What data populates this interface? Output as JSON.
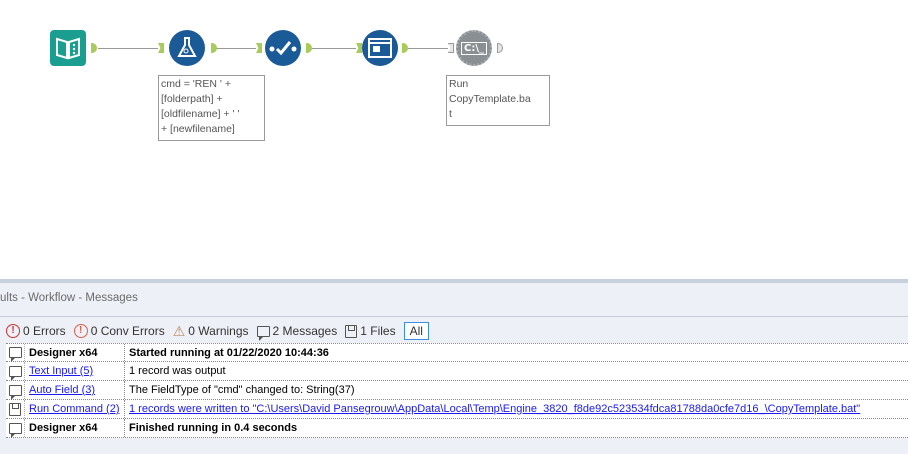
{
  "workflow": {
    "tools": [
      {
        "name": "Text Input",
        "icon": "book-icon",
        "color": "#1a9e8f"
      },
      {
        "name": "Formula",
        "icon": "flask-icon",
        "color": "#1a5a96",
        "annotation": [
          "cmd = 'REN ' +",
          "[folderpath] +",
          "[oldfilename] + ' '",
          "+ [newfilename]"
        ]
      },
      {
        "name": "Auto Field",
        "icon": "check-icon",
        "color": "#1a5a96"
      },
      {
        "name": "Run Command",
        "icon": "window-icon",
        "color": "#1a5a96"
      },
      {
        "name": "Run Command Disabled",
        "icon": "cmd-gear-icon",
        "color": "#8a8f94",
        "glyph": "C:\\_",
        "annotation": [
          "Run",
          "CopyTemplate.ba",
          "t"
        ]
      }
    ]
  },
  "panel": {
    "title": "ults - Workflow - Messages",
    "filters": [
      {
        "label": "0 Errors"
      },
      {
        "label": "0 Conv Errors"
      },
      {
        "label": "0 Warnings"
      },
      {
        "label": "2 Messages"
      },
      {
        "label": "1 Files"
      },
      {
        "label": "All"
      }
    ],
    "rows": [
      {
        "source": "Designer x64",
        "message": "Started running at 01/22/2020 10:44:36"
      },
      {
        "source": "Text Input (5)",
        "message": "1 record was output"
      },
      {
        "source": "Auto Field (3)",
        "message": "The FieldType of \"cmd\" changed to: String(37)"
      },
      {
        "source": "Run Command (2)",
        "message": "1 records were written to \"C:\\Users\\David Pansegrouw\\AppData\\Local\\Temp\\Engine_3820_f8de92c523534fdca81788da0cfe7d16_\\CopyTemplate.bat\""
      },
      {
        "source": "Designer x64",
        "message": "Finished running in 0.4 seconds"
      }
    ]
  }
}
